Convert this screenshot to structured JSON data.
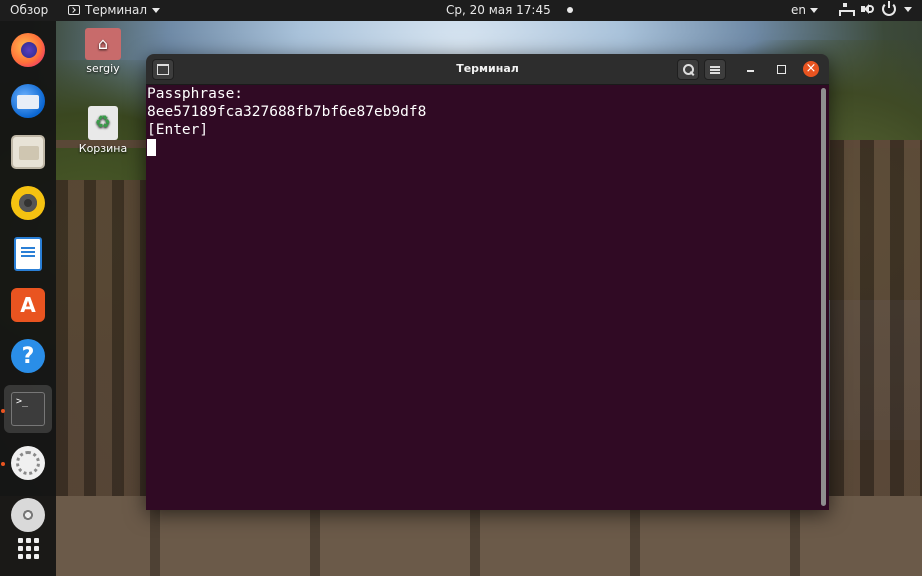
{
  "topbar": {
    "overview": "Обзор",
    "app_name": "Терминал",
    "datetime": "Ср, 20 мая  17:45",
    "lang": "en"
  },
  "desktop": {
    "home_label": "sergiy",
    "trash_label": "Корзина"
  },
  "dock": {
    "items": [
      {
        "name": "firefox-icon"
      },
      {
        "name": "thunderbird-icon"
      },
      {
        "name": "files-icon"
      },
      {
        "name": "rhythmbox-icon"
      },
      {
        "name": "libreoffice-writer-icon"
      },
      {
        "name": "software-store-icon"
      },
      {
        "name": "help-icon"
      },
      {
        "name": "terminal-icon"
      },
      {
        "name": "settings-icon"
      },
      {
        "name": "dvd-icon"
      },
      {
        "name": "show-apps-icon"
      }
    ],
    "store_glyph": "A",
    "help_glyph": "?",
    "terminal_glyph": ">_"
  },
  "window": {
    "title": "Терминал",
    "lines": [
      "Passphrase:",
      "8ee57189fca327688fb7bf6e87eb9df8",
      "[Enter]"
    ]
  },
  "colors": {
    "terminal_bg": "#300a24",
    "accent": "#e95420",
    "topbar_bg": "#1d1d1d"
  }
}
